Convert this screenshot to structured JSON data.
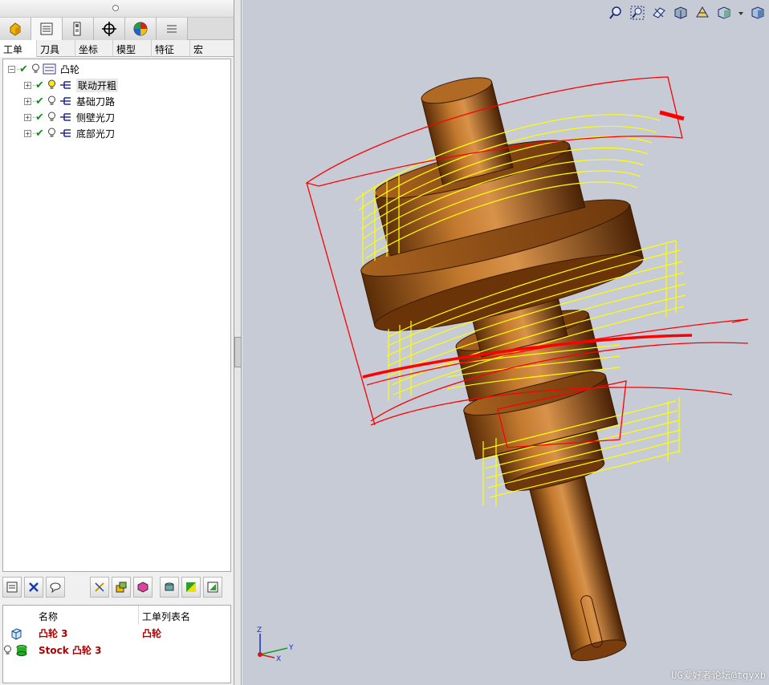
{
  "left_panel": {
    "icon_tabs": [
      "cam-part-icon",
      "operation-list-icon",
      "tool-list-icon",
      "crosshair-icon",
      "color-wheel-icon",
      "menu-lines-icon"
    ],
    "text_tabs": [
      "工单",
      "刀具",
      "坐标",
      "模型",
      "特征",
      "宏"
    ],
    "tree": {
      "root": "凸轮",
      "items": [
        "联动开粗",
        "基础刀路",
        "侧壁光刀",
        "底部光刀"
      ]
    },
    "ops_list": {
      "col_name": "名称",
      "col_list": "工单列表名",
      "rows": [
        {
          "name": "凸轮 3",
          "list": "凸轮"
        },
        {
          "name": "Stock 凸轮 3",
          "list": ""
        }
      ]
    }
  },
  "viewport": {
    "watermark": "UG爱好者论坛@tgyxb",
    "axis": {
      "x": "X",
      "y": "Y",
      "z": "Z"
    },
    "toolbar_icons": [
      "zoom-icon",
      "zoom-fit-icon",
      "sectioning-icon",
      "view-style-icon",
      "shading-icon",
      "display-mode-icon",
      "view-cube-icon"
    ]
  },
  "colors": {
    "part": "#8b4a12",
    "toolpath_cut": "#ffff00",
    "toolpath_rapid": "#ff0000",
    "background": "#c6cbd6"
  }
}
